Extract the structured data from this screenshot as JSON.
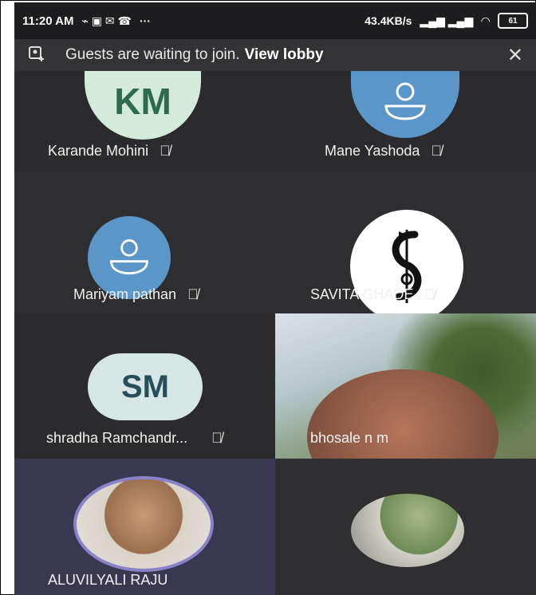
{
  "status_bar": {
    "time": "11:20 AM",
    "network_speed": "43.4KB/s",
    "battery": "61"
  },
  "banner": {
    "message": "Guests are waiting to join.",
    "action_label": "View lobby"
  },
  "participants": [
    {
      "name": "Karande Mohini",
      "initials": "KM",
      "muted": true,
      "avatar": "initials"
    },
    {
      "name": "Mane Yashoda",
      "muted": true,
      "avatar": "default-person-icon"
    },
    {
      "name": "Mariyam pathan",
      "muted": true,
      "avatar": "default-person-icon"
    },
    {
      "name": "SAVITA GHADE",
      "muted": true,
      "avatar": "logo-image"
    },
    {
      "name": "shradha Ramchandr...",
      "initials": "SM",
      "muted": true,
      "avatar": "initials"
    },
    {
      "name": "bhosale n m",
      "muted": false,
      "avatar": "live-video"
    },
    {
      "name": "ALUVILYALI RAJU",
      "muted": false,
      "avatar": "photo"
    },
    {
      "name": "",
      "muted": false,
      "avatar": "photo"
    }
  ],
  "colors": {
    "tile_bg": "#2b2b2d",
    "banner_bg": "#333335",
    "avatar_green": "#d4eadb",
    "avatar_blue": "#5b96c9",
    "active_speaker_ring": "#8a82c8"
  }
}
